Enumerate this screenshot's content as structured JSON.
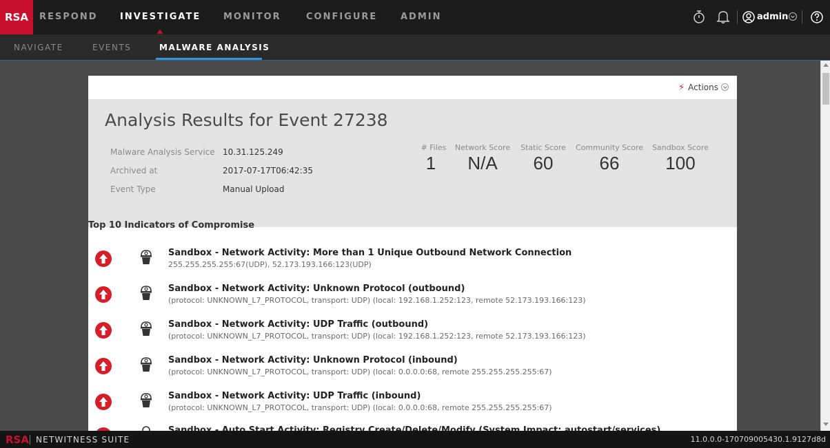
{
  "topnav": {
    "logo": "RSA",
    "items": [
      {
        "label": "RESPOND",
        "active": false
      },
      {
        "label": "INVESTIGATE",
        "active": true
      },
      {
        "label": "MONITOR",
        "active": false
      },
      {
        "label": "CONFIGURE",
        "active": false
      },
      {
        "label": "ADMIN",
        "active": false
      }
    ],
    "user_label": "admin",
    "icons": [
      "stopwatch-icon",
      "bell-icon",
      "user-icon",
      "chevron-down-icon",
      "help-icon"
    ]
  },
  "subnav": {
    "items": [
      {
        "label": "NAVIGATE",
        "active": false
      },
      {
        "label": "EVENTS",
        "active": false
      },
      {
        "label": "MALWARE ANALYSIS",
        "active": true
      }
    ]
  },
  "card": {
    "actions_label": "Actions",
    "title": "Analysis Results for Event 27238",
    "meta": [
      {
        "label": "Malware Analysis Service",
        "value": "10.31.125.249"
      },
      {
        "label": "Archived at",
        "value": "2017-07-17T06:42:35"
      },
      {
        "label": "Event Type",
        "value": "Manual Upload"
      }
    ],
    "scores": [
      {
        "label": "# Files",
        "value": "1"
      },
      {
        "label": "Network Score",
        "value": "N/A"
      },
      {
        "label": "Static Score",
        "value": "60"
      },
      {
        "label": "Community Score",
        "value": "66"
      },
      {
        "label": "Sandbox Score",
        "value": "100"
      }
    ],
    "ioc_title": "Top 10 Indicators of Compromise",
    "iocs": [
      {
        "name": "Sandbox - Network Activity: More than 1 Unique Outbound Network Connection",
        "detail": "255.255.255.255:67(UDP), 52.173.193.166:123(UDP)"
      },
      {
        "name": "Sandbox - Network Activity: Unknown Protocol (outbound)",
        "detail": "(protocol: UNKNOWN_L7_PROTOCOL, transport: UDP) (local: 192.168.1.252:123, remote 52.173.193.166:123)"
      },
      {
        "name": "Sandbox - Network Activity: UDP Traffic (outbound)",
        "detail": "(protocol: UNKNOWN_L7_PROTOCOL, transport: UDP) (local: 192.168.1.252:123, remote 52.173.193.166:123)"
      },
      {
        "name": "Sandbox - Network Activity: Unknown Protocol (inbound)",
        "detail": "(protocol: UNKNOWN_L7_PROTOCOL, transport: UDP) (local: 0.0.0.0:68, remote 255.255.255.255:67)"
      },
      {
        "name": "Sandbox - Network Activity: UDP Traffic (inbound)",
        "detail": "(protocol: UNKNOWN_L7_PROTOCOL, transport: UDP) (local: 0.0.0.0:68, remote 255.255.255.255:67)"
      },
      {
        "name": "Sandbox - Auto Start Activity: Registry Create/Delete/Modify (System Impact: autostart/services)"
      }
    ]
  },
  "footer": {
    "logo": "RSA",
    "title": "NETWITNESS SUITE",
    "version": "11.0.0.0-170709005430.1.9127d8d"
  },
  "colors": {
    "brand_red": "#c8102e",
    "tab_accent": "#2f95d9",
    "severity_red": "#d61e2a"
  }
}
